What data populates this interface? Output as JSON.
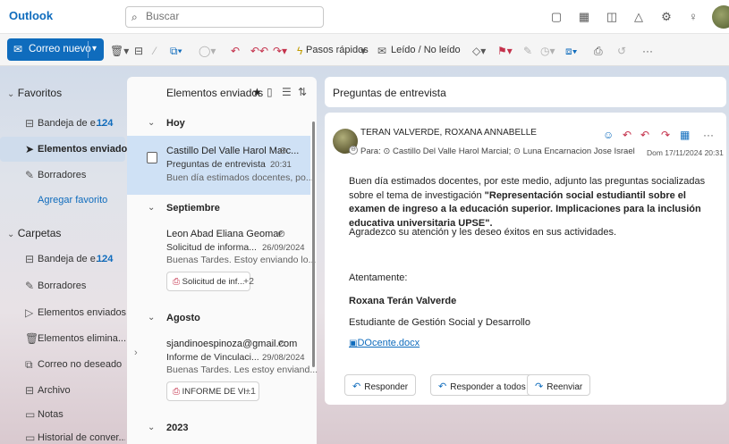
{
  "app": {
    "title": "Outlook"
  },
  "search": {
    "placeholder": "Buscar"
  },
  "topbar_icons": [
    "meet-now-icon",
    "calendar-icon",
    "feedback-icon",
    "bell-icon",
    "settings-icon",
    "lightbulb-icon"
  ],
  "ribbon": {
    "new_mail": "Correo nuevo",
    "quick_steps": "Pasos rápidos",
    "read_unread": "Leído / No leído"
  },
  "nav": {
    "favorites_label": "Favoritos",
    "favorites": [
      {
        "label": "Bandeja de e...",
        "count": "124"
      },
      {
        "label": "Elementos enviados",
        "count": ""
      },
      {
        "label": "Borradores",
        "count": ""
      }
    ],
    "add_favorite": "Agregar favorito",
    "folders_label": "Carpetas",
    "folders": [
      {
        "label": "Bandeja de e...",
        "count": "124"
      },
      {
        "label": "Borradores",
        "count": ""
      },
      {
        "label": "Elementos enviados",
        "count": ""
      },
      {
        "label": "Elementos elimina...",
        "count": ""
      },
      {
        "label": "Correo no deseado",
        "count": ""
      },
      {
        "label": "Archivo",
        "count": ""
      },
      {
        "label": "Notas",
        "count": ""
      },
      {
        "label": "Historial de conver...",
        "count": ""
      }
    ]
  },
  "message_list": {
    "title": "Elementos enviados",
    "groups": {
      "today": "Hoy",
      "september": "Septiembre",
      "august": "Agosto",
      "y2023": "2023"
    },
    "messages": [
      {
        "from": "Castillo Del Valle Harol Marc...",
        "subject": "Preguntas de entrevista",
        "date": "20:31",
        "preview": "Buen día estimados docentes, po..."
      },
      {
        "from": "Leon Abad Eliana Geomar",
        "subject": "Solicitud de informa...",
        "date": "26/09/2024",
        "preview": "Buenas Tardes. Estoy enviando lo...",
        "attachment": "Solicitud de inf...",
        "more": "+2"
      },
      {
        "from": "sjandinoespinoza@gmail.com",
        "subject": "Informe de Vinculaci...",
        "date": "29/08/2024",
        "preview": "Buenas Tardes. Les estoy enviand...",
        "attachment": "INFORME DE VI...",
        "more": "+1"
      }
    ]
  },
  "reading": {
    "header": "Preguntas de entrevista",
    "sender": "TERAN VALVERDE, ROXANA ANNABELLE",
    "to_label": "Para:",
    "to_1": "Castillo Del Valle Harol Marcial;",
    "to_2": "Luna Encarnacion Jose Israel",
    "date": "Dom 17/11/2024 20:31",
    "body_intro": "Buen día estimados docentes, por este medio, adjunto las preguntas socializadas sobre el tema de investigación ",
    "body_bold": "\"Representación social estudiantil sobre el examen de ingreso a la educación superior. Implicaciones para la inclusión educativa universitaria UPSE\".",
    "body_thanks": "Agradezco su atención y les deseo éxitos en sus actividades.",
    "closing": "Atentamente:",
    "signature_name": "Roxana Terán Valverde",
    "signature_role": "Estudiante de Gestión Social y Desarrollo",
    "attachment_link": "DOcente.docx",
    "reply": "Responder",
    "reply_all": "Responder a todos",
    "forward": "Reenviar"
  },
  "colors": {
    "accent": "#0f6cbd",
    "selected": "#cfe1f5",
    "danger": "#c4314b"
  }
}
